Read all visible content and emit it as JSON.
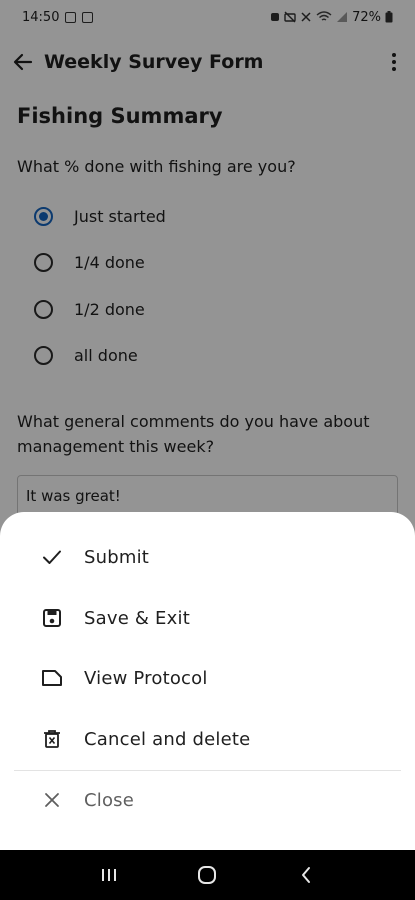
{
  "status_bar": {
    "time": "14:50",
    "battery": "72%"
  },
  "app_bar": {
    "title": "Weekly Survey Form"
  },
  "form": {
    "section_title": "Fishing Summary",
    "question_1": "What % done with fishing are you?",
    "options": [
      "Just started",
      "1/4 done",
      "1/2 done",
      "all done"
    ],
    "selected_option": "Just started",
    "question_2": "What general comments do you have about management this week?",
    "answer_2": "It was great!"
  },
  "sheet": {
    "submit": "Submit",
    "save_exit": "Save & Exit",
    "view_protocol": "View Protocol",
    "cancel_delete": "Cancel and delete",
    "close": "Close"
  },
  "colors": {
    "accent": "#1565c0",
    "scrim": "rgba(0,0,0,0.42)"
  }
}
